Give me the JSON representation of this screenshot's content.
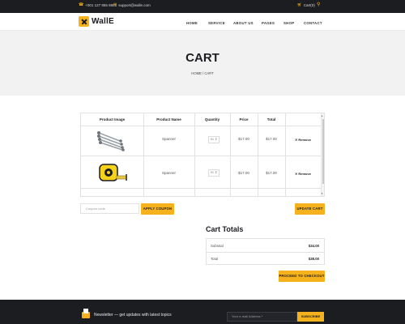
{
  "topbar": {
    "phone": "+001 127 855 8881",
    "email": "support@walle.com",
    "cart": "Cart(0)"
  },
  "logo": {
    "text": "WallE"
  },
  "nav": {
    "items": [
      "HOME",
      "SERVICE",
      "ABOUT US",
      "PAGES",
      "SHOP",
      "CONTACT"
    ]
  },
  "hero": {
    "title": "CART",
    "breadcrumb": "HOME / CART"
  },
  "cart": {
    "headers": [
      "Product Image",
      "Product Name",
      "Quantity",
      "Price",
      "Total"
    ],
    "rows": [
      {
        "image": "spanner-set-image",
        "name": "Spanner",
        "qty": "01",
        "price": "$17.00",
        "total": "$17.00",
        "remove": "Remove"
      },
      {
        "image": "tape-measure-image",
        "name": "Spanner",
        "qty": "01",
        "price": "$17.00",
        "total": "$17.00",
        "remove": "Remove"
      }
    ]
  },
  "coupon": {
    "placeholder": "Coupon code",
    "apply_label": "APPLY COUPON",
    "update_label": "UPDATE CART"
  },
  "totals": {
    "title": "Cart Totals",
    "subtotal_label": "Subtotal",
    "subtotal_value": "$34.00",
    "total_label": "Total",
    "total_value": "$38.00",
    "checkout_label": "PROCEED TO CHECKOUT"
  },
  "footer": {
    "newsletter": "Newsletter — get updates with latest topics",
    "email_placeholder": "Your e-mail Address *",
    "subscribe_label": "SUBSCRIBE"
  },
  "colors": {
    "accent": "#f5b21c",
    "dark": "#1c1d21",
    "hero_bg": "#f2f2f2"
  }
}
